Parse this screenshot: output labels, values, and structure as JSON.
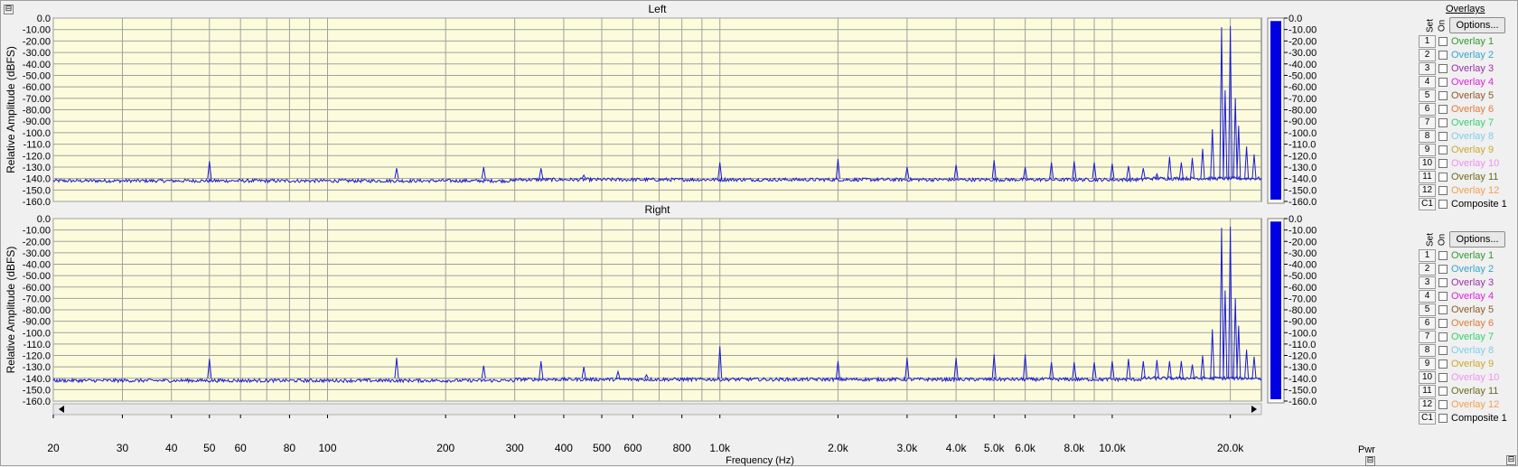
{
  "window": {
    "collapse_icon": "⊟",
    "corner_icon": "⊟"
  },
  "x_axis": {
    "label": "Frequency (Hz)",
    "min": 20,
    "max": 24000,
    "scale": "log",
    "ticks": [
      {
        "v": 20,
        "t": "20"
      },
      {
        "v": 30,
        "t": "30"
      },
      {
        "v": 40,
        "t": "40"
      },
      {
        "v": 50,
        "t": "50"
      },
      {
        "v": 60,
        "t": "60"
      },
      {
        "v": 80,
        "t": "80"
      },
      {
        "v": 100,
        "t": "100"
      },
      {
        "v": 200,
        "t": "200"
      },
      {
        "v": 300,
        "t": "300"
      },
      {
        "v": 400,
        "t": "400"
      },
      {
        "v": 500,
        "t": "500"
      },
      {
        "v": 600,
        "t": "600"
      },
      {
        "v": 800,
        "t": "800"
      },
      {
        "v": 1000,
        "t": "1.0k"
      },
      {
        "v": 2000,
        "t": "2.0k"
      },
      {
        "v": 3000,
        "t": "3.0k"
      },
      {
        "v": 4000,
        "t": "4.0k"
      },
      {
        "v": 5000,
        "t": "5.0k"
      },
      {
        "v": 6000,
        "t": "6.0k"
      },
      {
        "v": 8000,
        "t": "8.0k"
      },
      {
        "v": 10000,
        "t": "10.0k"
      },
      {
        "v": 20000,
        "t": "20.0k"
      }
    ]
  },
  "overlays": {
    "title": "Overlays",
    "options_label": "Options...",
    "set_header": "Set",
    "on_header": "On",
    "items": [
      {
        "num": "1",
        "label": "Overlay 1",
        "color": "#2e9a2e"
      },
      {
        "num": "2",
        "label": "Overlay 2",
        "color": "#36a6c8"
      },
      {
        "num": "3",
        "label": "Overlay 3",
        "color": "#9b2fa8"
      },
      {
        "num": "4",
        "label": "Overlay 4",
        "color": "#e020e0"
      },
      {
        "num": "5",
        "label": "Overlay 5",
        "color": "#8a5a2a"
      },
      {
        "num": "6",
        "label": "Overlay 6",
        "color": "#e07a3a"
      },
      {
        "num": "7",
        "label": "Overlay 7",
        "color": "#30d070"
      },
      {
        "num": "8",
        "label": "Overlay 8",
        "color": "#7ad0e8"
      },
      {
        "num": "9",
        "label": "Overlay 9",
        "color": "#c8a830"
      },
      {
        "num": "10",
        "label": "Overlay 10",
        "color": "#f090f0"
      },
      {
        "num": "11",
        "label": "Overlay 11",
        "color": "#6a6a20"
      },
      {
        "num": "12",
        "label": "Overlay 12",
        "color": "#f0a050"
      },
      {
        "num": "C1",
        "label": "Composite 1",
        "color": "#000000"
      }
    ]
  },
  "pwr": {
    "label": "Pwr",
    "bar_color": "#0000e0"
  },
  "colors": {
    "plot_bg": "#fcfcdc",
    "trace": "#1a1ad0",
    "grid": "#a0a0a0",
    "frame_bg": "#f0f0f0"
  },
  "chart_data": [
    {
      "type": "line",
      "title": "Left",
      "ylabel": "Relative Amplitude (dBFS)",
      "xlabel": "Frequency (Hz)",
      "xscale": "log",
      "xlim": [
        20,
        24000
      ],
      "ylim": [
        -160,
        0
      ],
      "yticks": [
        "0.0",
        "-10.00",
        "-20.00",
        "-30.00",
        "-40.00",
        "-50.00",
        "-60.00",
        "-70.00",
        "-80.00",
        "-90.00",
        "-100.0",
        "-110.0",
        "-120.0",
        "-130.0",
        "-140.0",
        "-150.0",
        "-160.0"
      ],
      "grid": true,
      "noise_floor": -141,
      "peaks": [
        {
          "f": 50,
          "db": -125
        },
        {
          "f": 150,
          "db": -131
        },
        {
          "f": 250,
          "db": -130
        },
        {
          "f": 350,
          "db": -131
        },
        {
          "f": 450,
          "db": -137
        },
        {
          "f": 1000,
          "db": -126
        },
        {
          "f": 2000,
          "db": -123
        },
        {
          "f": 3000,
          "db": -130
        },
        {
          "f": 4000,
          "db": -128
        },
        {
          "f": 5000,
          "db": -124
        },
        {
          "f": 6000,
          "db": -130
        },
        {
          "f": 7000,
          "db": -126
        },
        {
          "f": 8000,
          "db": -125
        },
        {
          "f": 9000,
          "db": -126
        },
        {
          "f": 10000,
          "db": -127
        },
        {
          "f": 11000,
          "db": -129
        },
        {
          "f": 12000,
          "db": -131
        },
        {
          "f": 13000,
          "db": -136
        },
        {
          "f": 14000,
          "db": -121
        },
        {
          "f": 15000,
          "db": -126
        },
        {
          "f": 16000,
          "db": -122
        },
        {
          "f": 17000,
          "db": -114
        },
        {
          "f": 18000,
          "db": -97
        },
        {
          "f": 19000,
          "db": -8
        },
        {
          "f": 19400,
          "db": -63
        },
        {
          "f": 20000,
          "db": -7
        },
        {
          "f": 20600,
          "db": -70
        },
        {
          "f": 21000,
          "db": -94
        },
        {
          "f": 22000,
          "db": -112
        },
        {
          "f": 23000,
          "db": -119
        }
      ],
      "pwr_level": -1
    },
    {
      "type": "line",
      "title": "Right",
      "ylabel": "Relative Amplitude (dBFS)",
      "xlabel": "Frequency (Hz)",
      "xscale": "log",
      "xlim": [
        20,
        24000
      ],
      "ylim": [
        -160,
        0
      ],
      "yticks": [
        "0.0",
        "-10.00",
        "-20.00",
        "-30.00",
        "-40.00",
        "-50.00",
        "-60.00",
        "-70.00",
        "-80.00",
        "-90.00",
        "-100.0",
        "-110.0",
        "-120.0",
        "-130.0",
        "-140.0",
        "-150.0",
        "-160.0"
      ],
      "grid": true,
      "noise_floor": -141,
      "peaks": [
        {
          "f": 50,
          "db": -123
        },
        {
          "f": 150,
          "db": -122
        },
        {
          "f": 250,
          "db": -129
        },
        {
          "f": 350,
          "db": -125
        },
        {
          "f": 450,
          "db": -130
        },
        {
          "f": 550,
          "db": -134
        },
        {
          "f": 650,
          "db": -137
        },
        {
          "f": 1000,
          "db": -112
        },
        {
          "f": 2000,
          "db": -125
        },
        {
          "f": 3000,
          "db": -122
        },
        {
          "f": 4000,
          "db": -122
        },
        {
          "f": 5000,
          "db": -119
        },
        {
          "f": 6000,
          "db": -119
        },
        {
          "f": 7000,
          "db": -126
        },
        {
          "f": 8000,
          "db": -126
        },
        {
          "f": 9000,
          "db": -126
        },
        {
          "f": 10000,
          "db": -125
        },
        {
          "f": 11000,
          "db": -123
        },
        {
          "f": 12000,
          "db": -125
        },
        {
          "f": 13000,
          "db": -124
        },
        {
          "f": 14000,
          "db": -125
        },
        {
          "f": 15000,
          "db": -125
        },
        {
          "f": 16000,
          "db": -128
        },
        {
          "f": 17000,
          "db": -120
        },
        {
          "f": 18000,
          "db": -97
        },
        {
          "f": 19000,
          "db": -8
        },
        {
          "f": 19400,
          "db": -63
        },
        {
          "f": 20000,
          "db": -7
        },
        {
          "f": 20600,
          "db": -70
        },
        {
          "f": 21000,
          "db": -94
        },
        {
          "f": 22000,
          "db": -115
        },
        {
          "f": 23000,
          "db": -121
        }
      ],
      "pwr_level": -1
    }
  ]
}
